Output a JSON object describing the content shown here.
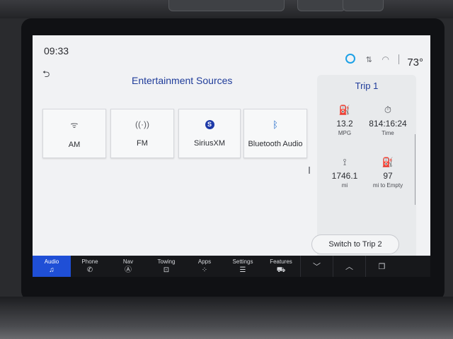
{
  "status": {
    "time": "09:33",
    "temperature": "73°"
  },
  "main": {
    "title": "Entertainment Sources"
  },
  "sources": [
    {
      "label": "AM",
      "icon": "antenna-icon"
    },
    {
      "label": "FM",
      "icon": "radio-waves-icon"
    },
    {
      "label": "SiriusXM",
      "icon": "siriusxm-icon"
    },
    {
      "label": "Bluetooth Audio",
      "icon": "bluetooth-icon"
    }
  ],
  "trip": {
    "title": "Trip 1",
    "mpg_value": "13.2",
    "mpg_unit": "MPG",
    "time_value": "814:16:24",
    "time_unit": "Time",
    "distance_value": "1746.1",
    "distance_unit": "mi",
    "empty_value": "97",
    "empty_unit": "mi to Empty",
    "switch_label": "Switch to Trip 2"
  },
  "nav": [
    {
      "label": "Audio",
      "icon": "music-note-icon",
      "active": true
    },
    {
      "label": "Phone",
      "icon": "phone-icon"
    },
    {
      "label": "Nav",
      "icon": "navigation-icon"
    },
    {
      "label": "Towing",
      "icon": "trailer-icon"
    },
    {
      "label": "Apps",
      "icon": "apps-grid-icon"
    },
    {
      "label": "Settings",
      "icon": "settings-sliders-icon"
    },
    {
      "label": "Features",
      "icon": "truck-icon"
    }
  ],
  "colors": {
    "accent": "#1f4fd6",
    "title_blue": "#1f3c9a",
    "nav_bg": "#17181b"
  }
}
